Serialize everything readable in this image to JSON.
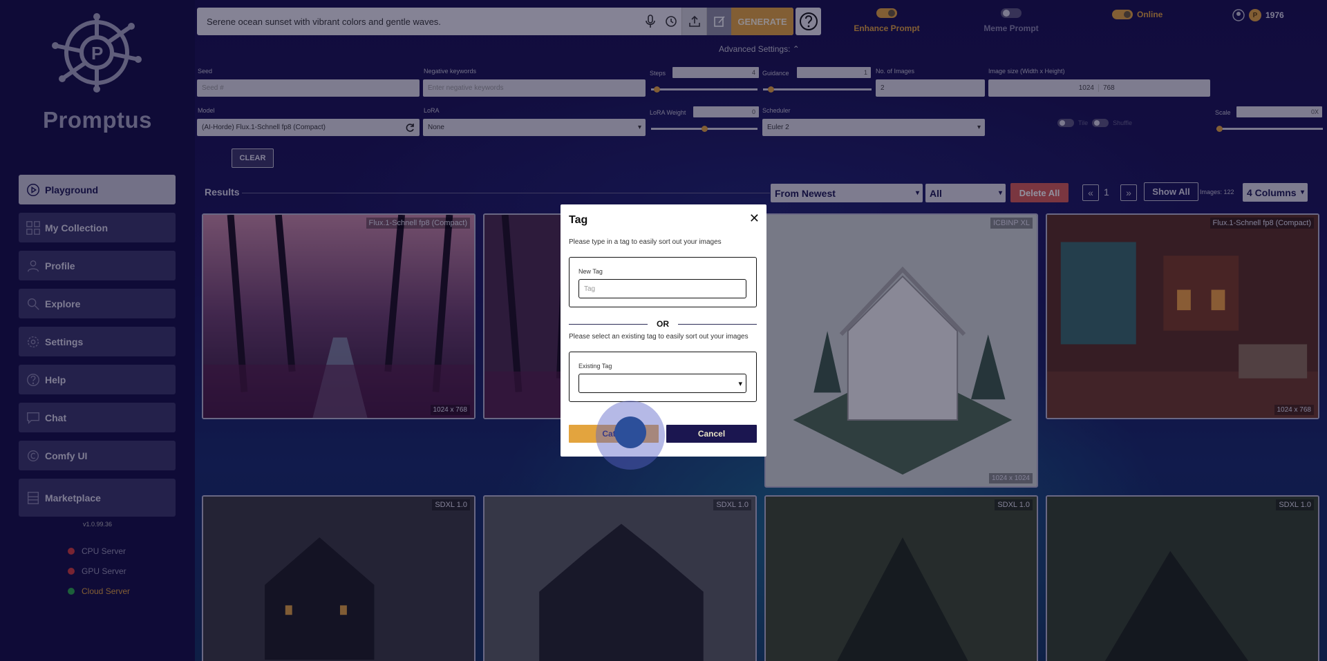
{
  "brand": {
    "name": "Promptus"
  },
  "sidebar": {
    "items": [
      {
        "label": "Playground",
        "icon": "play-icon"
      },
      {
        "label": "My Collection",
        "icon": "grid-icon"
      },
      {
        "label": "Profile",
        "icon": "user-icon"
      },
      {
        "label": "Explore",
        "icon": "search-icon"
      },
      {
        "label": "Settings",
        "icon": "gear-icon"
      },
      {
        "label": "Help",
        "icon": "question-icon"
      },
      {
        "label": "Chat",
        "icon": "chat-icon"
      },
      {
        "label": "Comfy UI",
        "icon": "comfy-icon"
      },
      {
        "label": "Marketplace",
        "icon": "store-icon"
      }
    ],
    "version": "v1.0.99.36",
    "servers": [
      {
        "label": "CPU Server",
        "color": "#d13b3b"
      },
      {
        "label": "GPU Server",
        "color": "#d13b3b"
      },
      {
        "label": "Cloud Server",
        "color": "#2aa84a"
      }
    ]
  },
  "prompt": {
    "value": "Serene ocean sunset with vibrant colors and gentle waves.",
    "generate_label": "GENERATE"
  },
  "options": {
    "enhance_label": "Enhance Prompt",
    "meme_label": "Meme Prompt",
    "online_label": "Online"
  },
  "balance": {
    "coin_letter": "P",
    "amount": "1976"
  },
  "advanced": {
    "title": "Advanced Settings:",
    "seed_label": "Seed",
    "seed_placeholder": "Seed #",
    "negative_label": "Negative keywords",
    "negative_placeholder": "Enter negative keywords",
    "steps_label": "Steps",
    "steps_value": "4",
    "guidance_label": "Guidance",
    "guidance_value": "1",
    "num_images_label": "No. of Images",
    "num_images_value": "2",
    "image_size_label": "Image size (Width x Height)",
    "width": "1024",
    "height": "768",
    "model_label": "Model",
    "model_value": "(AI-Horde) Flux.1-Schnell fp8 (Compact)",
    "lora_label": "LoRA",
    "lora_value": "None",
    "lora_weight_label": "LoRA Weight",
    "lora_weight_value": "0",
    "scheduler_label": "Scheduler",
    "scheduler_value": "Euler 2",
    "tile_label": "Tile",
    "shuffle_label": "Shuffle",
    "scale_label": "Scale",
    "scale_value": "0X",
    "clear_label": "CLEAR"
  },
  "results": {
    "title": "Results",
    "sort_value": "From Newest",
    "filter_value": "All",
    "delete_all_label": "Delete All",
    "page": "1",
    "show_all_label": "Show All",
    "images_count": "Images: 122",
    "columns_value": "4 Columns"
  },
  "cards": [
    {
      "model": "Flux.1-Schnell fp8 (Compact)",
      "size": "1024 x 768"
    },
    {
      "model": "",
      "size": ""
    },
    {
      "model": "ICBINP XL",
      "size": "1024 x 1024"
    },
    {
      "model": "Flux.1-Schnell fp8 (Compact)",
      "size": "1024 x 768"
    },
    {
      "model": "SDXL 1.0",
      "size": ""
    },
    {
      "model": "SDXL 1.0",
      "size": ""
    },
    {
      "model": "SDXL 1.0",
      "size": ""
    },
    {
      "model": "SDXL 1.0",
      "size": ""
    }
  ],
  "modal": {
    "title": "Tag",
    "close": "✕",
    "new_text": "Please type in a tag to easily sort out your images",
    "new_tag_label": "New Tag",
    "new_tag_placeholder": "Tag",
    "or_label": "OR",
    "existing_text": "Please select an existing tag to easily sort out your images",
    "existing_tag_label": "Existing Tag",
    "existing_tag_value": "",
    "category_label": "Categ",
    "cancel_label": "Cancel"
  }
}
